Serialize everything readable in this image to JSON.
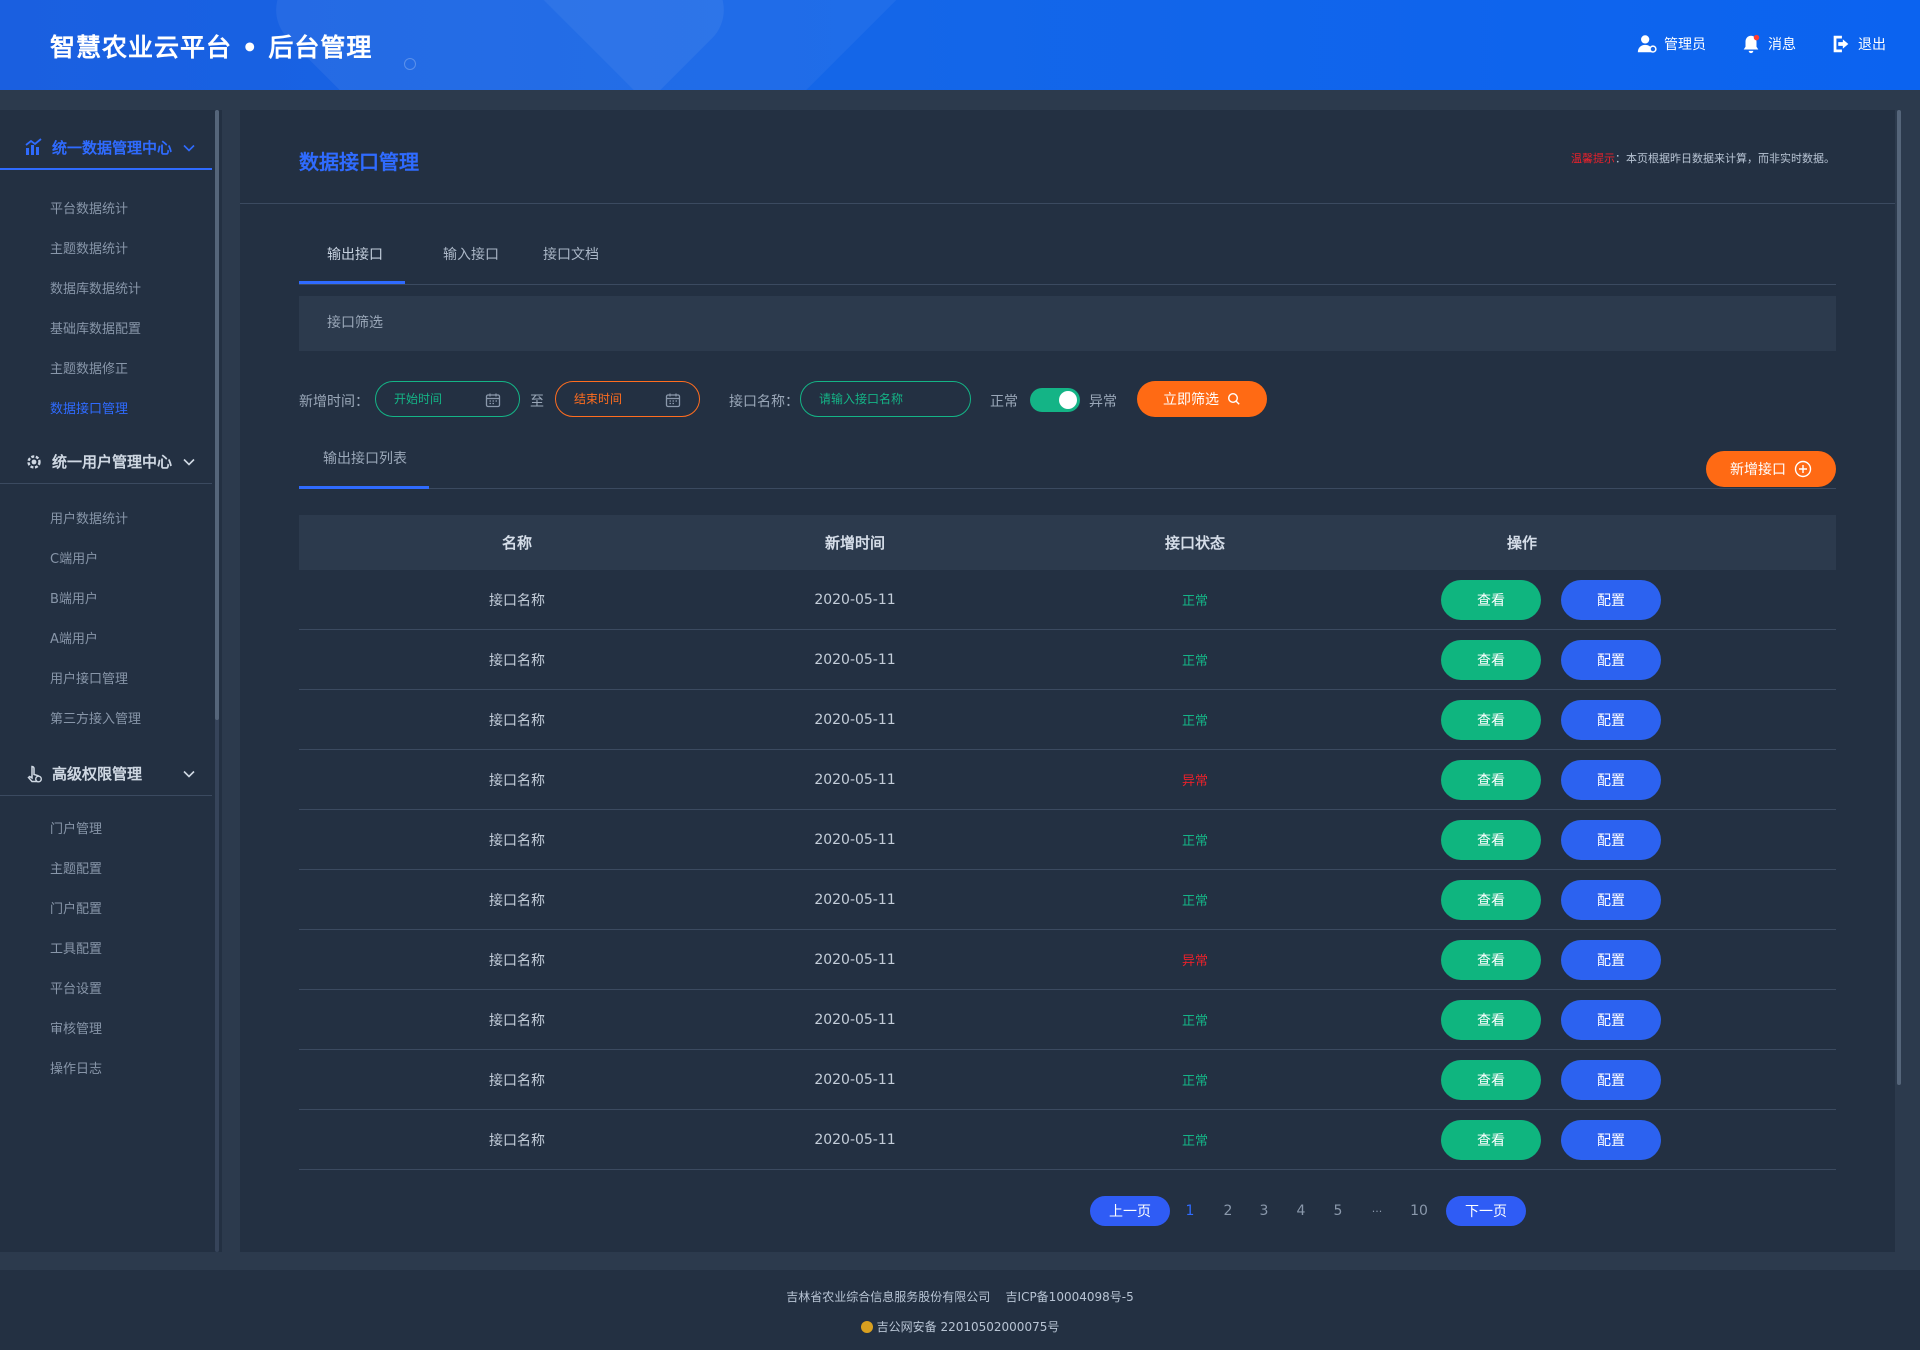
{
  "header": {
    "title": "智慧农业云平台 • 后台管理",
    "actions": {
      "admin": "管理员",
      "messages": "消息",
      "logout": "退出"
    }
  },
  "sidebar": {
    "groups": [
      {
        "title": "统一数据管理中心",
        "icon": "chart-icon",
        "items": [
          "平台数据统计",
          "主题数据统计",
          "数据库数据统计",
          "基础库数据配置",
          "主题数据修正",
          "数据接口管理"
        ]
      },
      {
        "title": "统一用户管理中心",
        "icon": "gear-icon",
        "items": [
          "用户数据统计",
          "C端用户",
          "B端用户",
          "A端用户",
          "用户接口管理",
          "第三方接入管理"
        ]
      },
      {
        "title": "高级权限管理",
        "icon": "touch-icon",
        "items": [
          "门户管理",
          "主题配置",
          "门户配置",
          "工具配置",
          "平台设置",
          "审核管理",
          "操作日志"
        ]
      }
    ],
    "active_item": "数据接口管理"
  },
  "main": {
    "title": "数据接口管理",
    "tip_label": "温馨提示",
    "tip_text": "：本页根据昨日数据来计算，而非实时数据。",
    "tabs": [
      "输出接口",
      "输入接口",
      "接口文档"
    ],
    "active_tab": "输出接口",
    "filter_bar_label": "接口筛选",
    "filters": {
      "date_label": "新增时间：",
      "start_placeholder": "开始时间",
      "to_label": "至",
      "end_placeholder": "结束时间",
      "name_label": "接口名称：",
      "name_placeholder": "请输入接口名称",
      "status_normal": "正常",
      "status_abnormal": "异常",
      "toggle_on": true,
      "submit_label": "立即筛选"
    },
    "list_title": "输出接口列表",
    "add_button": "新增接口",
    "table": {
      "headers": [
        "名称",
        "新增时间",
        "接口状态",
        "操作"
      ],
      "rows": [
        {
          "name": "接口名称",
          "date": "2020-05-11",
          "status": "正常"
        },
        {
          "name": "接口名称",
          "date": "2020-05-11",
          "status": "正常"
        },
        {
          "name": "接口名称",
          "date": "2020-05-11",
          "status": "正常"
        },
        {
          "name": "接口名称",
          "date": "2020-05-11",
          "status": "异常"
        },
        {
          "name": "接口名称",
          "date": "2020-05-11",
          "status": "正常"
        },
        {
          "name": "接口名称",
          "date": "2020-05-11",
          "status": "正常"
        },
        {
          "name": "接口名称",
          "date": "2020-05-11",
          "status": "异常"
        },
        {
          "name": "接口名称",
          "date": "2020-05-11",
          "status": "正常"
        },
        {
          "name": "接口名称",
          "date": "2020-05-11",
          "status": "正常"
        },
        {
          "name": "接口名称",
          "date": "2020-05-11",
          "status": "正常"
        }
      ],
      "view_label": "查看",
      "config_label": "配置"
    },
    "pagination": {
      "prev": "上一页",
      "next": "下一页",
      "pages": [
        "1",
        "2",
        "3",
        "4",
        "5",
        "···",
        "10"
      ],
      "current": "1"
    }
  },
  "footer": {
    "company": "吉林省农业综合信息服务股份有限公司",
    "icp": "吉ICP备10004098号-5",
    "police": "吉公网安备 22010502000075号"
  },
  "colors": {
    "accent": "#2f6bff",
    "success": "#14b486",
    "danger": "#e8212b",
    "orange": "#ff6a14",
    "panel": "#233042",
    "background": "#2c3a4d"
  }
}
